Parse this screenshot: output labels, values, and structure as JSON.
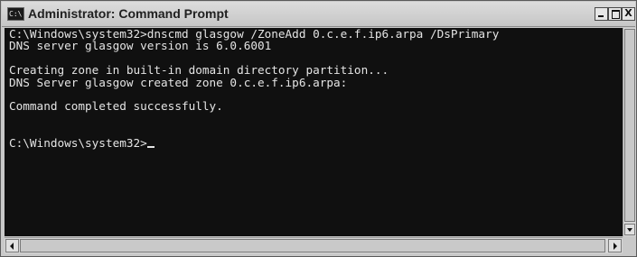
{
  "window": {
    "title": "Administrator: Command Prompt",
    "icon_glyph": "C:\\",
    "icon_name": "command-prompt-icon",
    "controls": {
      "minimize": "",
      "maximize": "",
      "close": "X"
    }
  },
  "console": {
    "lines": [
      "C:\\Windows\\system32>dnscmd glasgow /ZoneAdd 0.c.e.f.ip6.arpa /DsPrimary",
      "DNS server glasgow version is 6.0.6001",
      "",
      "Creating zone in built-in domain directory partition...",
      "DNS Server glasgow created zone 0.c.e.f.ip6.arpa:",
      "",
      "Command completed successfully.",
      "",
      "",
      "C:\\Windows\\system32>"
    ]
  },
  "colors": {
    "console_background": "#101010",
    "console_text": "#e4e4e4",
    "chrome": "#c9c9c9"
  }
}
